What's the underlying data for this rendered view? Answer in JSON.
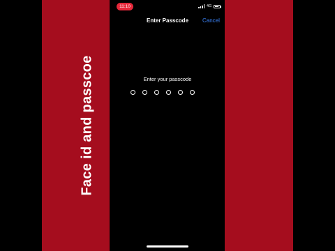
{
  "status_bar": {
    "time": "11:10",
    "network": "4G",
    "battery_icon": "battery-icon",
    "signal_icon": "signal-icon"
  },
  "navigation": {
    "title": "Enter Passcode",
    "cancel_label": "Cancel"
  },
  "passcode": {
    "prompt": "Enter your passcode",
    "digit_count": 6
  },
  "overlay": {
    "banner_text": "Face id and passcoe"
  },
  "colors": {
    "banner": "#a50d1e",
    "accent": "#3b82f6",
    "time_pill": "#e5283a"
  }
}
